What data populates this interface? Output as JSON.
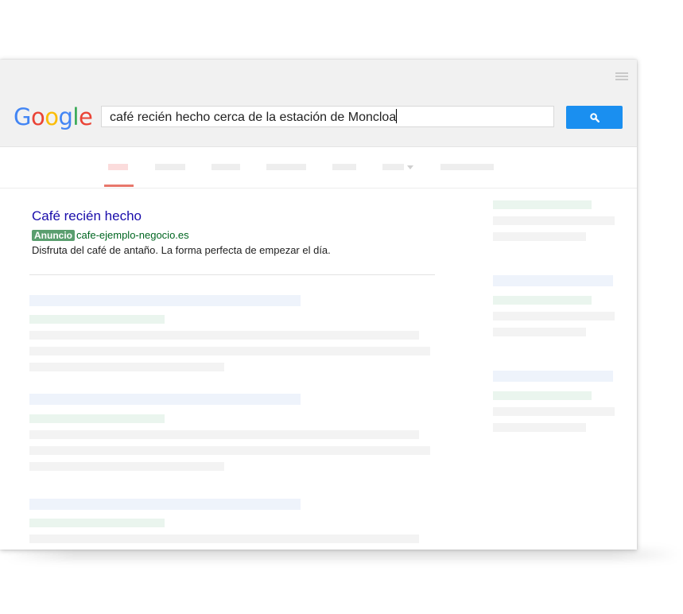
{
  "logo": {
    "letters": [
      "G",
      "o",
      "o",
      "g",
      "l",
      "e"
    ]
  },
  "search": {
    "query": "café recién hecho cerca de la estación de Moncloa"
  },
  "icons": {
    "search_button": "magnifier-icon",
    "menu": "hamburger-menu-icon",
    "tab_dropdown": "caret-down-icon"
  },
  "ad": {
    "title": "Café recién hecho",
    "badge": "Anuncio",
    "url": "cafe-ejemplo-negocio.es",
    "description": "Disfruta del café de antaño. La forma perfecta de empezar el día."
  },
  "colors": {
    "search_button": "#1a8ff0",
    "ad_title": "#1a0dab",
    "ad_badge": "#5a9e6f",
    "ad_url": "#006621",
    "active_tab_underline": "#e8776b"
  }
}
